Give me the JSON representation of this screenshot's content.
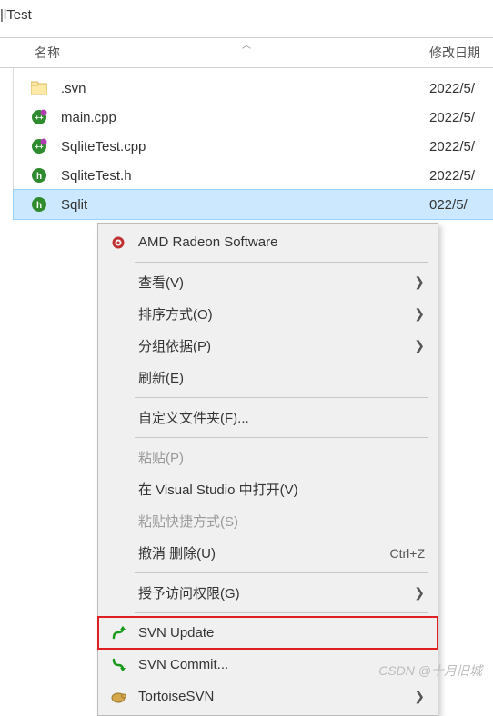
{
  "window": {
    "title": "|lTest"
  },
  "columns": {
    "name": "名称",
    "modified": "修改日期"
  },
  "files": [
    {
      "name": ".svn",
      "date": "2022/5/",
      "icon": "folder"
    },
    {
      "name": "main.cpp",
      "date": "2022/5/",
      "icon": "cpp"
    },
    {
      "name": "SqliteTest.cpp",
      "date": "2022/5/",
      "icon": "cpp"
    },
    {
      "name": "SqliteTest.h",
      "date": "2022/5/",
      "icon": "h"
    },
    {
      "name": "Sqlit",
      "date": "022/5/",
      "icon": "h",
      "selected": true
    }
  ],
  "menu": {
    "amd": "AMD Radeon Software",
    "view": "查看(V)",
    "sort": "排序方式(O)",
    "group": "分组依据(P)",
    "refresh": "刷新(E)",
    "customize": "自定义文件夹(F)...",
    "paste": "粘贴(P)",
    "openvs": "在 Visual Studio 中打开(V)",
    "paste_shortcut": "粘贴快捷方式(S)",
    "undo_delete": "撤消 删除(U)",
    "undo_shortcut": "Ctrl+Z",
    "grant": "授予访问权限(G)",
    "svn_update": "SVN Update",
    "svn_commit": "SVN Commit...",
    "tortoise": "TortoiseSVN"
  },
  "watermark": "CSDN @十月旧城"
}
